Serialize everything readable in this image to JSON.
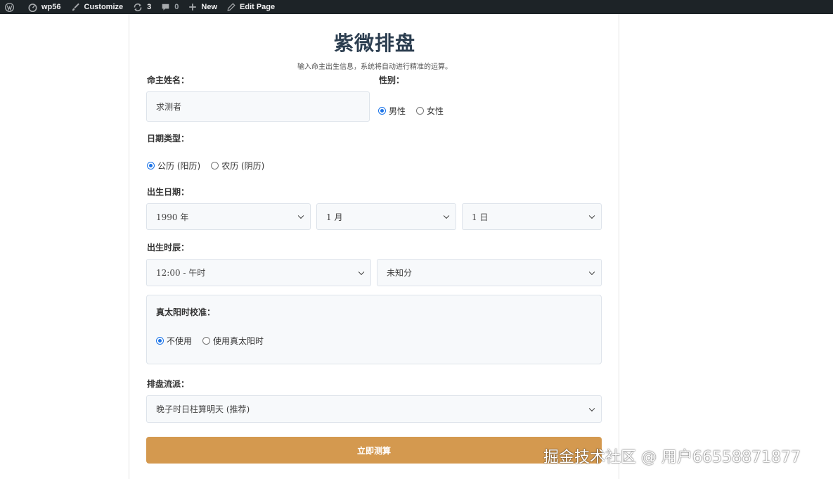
{
  "admin_bar": {
    "site_name": "wp56",
    "customize": "Customize",
    "updates_count": "3",
    "comments_count": "0",
    "new": "New",
    "edit_page": "Edit Page",
    "icons": [
      "wordpress-logo-icon",
      "site-dashboard-icon",
      "brush-icon",
      "update-icon",
      "comment-icon",
      "plus-icon",
      "pencil-icon"
    ]
  },
  "form": {
    "title": "紫微排盘",
    "subtitle": "输入命主出生信息，系统将自动进行精准的运算。",
    "name_label": "命主姓名：",
    "name_placeholder": "求测者",
    "gender_label": "性别：",
    "gender_options": [
      "男性",
      "女性"
    ],
    "gender_selected": "男性",
    "date_type_label": "日期类型：",
    "date_type_options": [
      "公历 (阳历)",
      "农历 (阴历)"
    ],
    "date_type_selected": "公历 (阳历)",
    "birth_date_label": "出生日期：",
    "year": "1990 年",
    "month": "1 月",
    "day": "1 日",
    "birth_time_label": "出生时辰：",
    "hour": "12:00 - 午时",
    "minute": "未知分",
    "solar_time_label": "真太阳时校准：",
    "solar_time_options": [
      "不使用",
      "使用真太阳时"
    ],
    "solar_time_selected": "不使用",
    "school_label": "排盘流派：",
    "school": "晚子时日柱算明天 (推荐)",
    "submit": "立即测算"
  },
  "watermark": "掘金技术社区 @ 用户66558871877",
  "colors": {
    "admin_bar_bg": "#1d2327",
    "submit_bg": "#d4994f",
    "radio_accent": "#1a73e8",
    "title": "#2c3e50"
  }
}
